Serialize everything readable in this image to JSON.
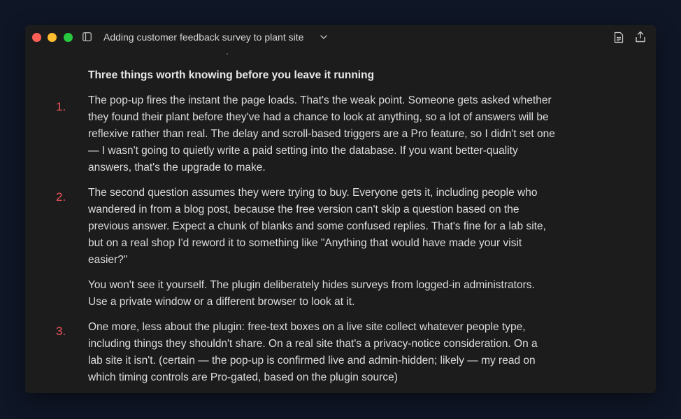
{
  "window": {
    "title": "Adding customer feedback survey to plant site"
  },
  "content": {
    "heading": "Three things worth knowing before you leave it running",
    "items": [
      {
        "number": "1.",
        "lines": [
          "The pop-up fires the instant the page loads. That's the weak point. Someone gets asked whether",
          "they found their plant before they've had a chance to look at anything, so a lot of answers will be",
          "reflexive rather than real. The delay and scroll-based triggers are a Pro feature, so I didn't set one",
          "— I wasn't going to quietly write a paid setting into the database. If you want better-quality",
          "answers, that's the upgrade to make."
        ]
      },
      {
        "number": "2.",
        "lines": [
          "The second question assumes they were trying to buy. Everyone gets it, including people who",
          "wandered in from a blog post, because the free version can't skip a question based on the",
          "previous answer. Expect a chunk of blanks and some confused replies. That's fine for a lab site,",
          "but on a real shop I'd reword it to something like \"Anything that would have made your visit",
          "easier?\""
        ]
      },
      {
        "number": "",
        "lines": [
          "You won't see it yourself. The plugin deliberately hides surveys from logged-in administrators.",
          "Use a private window or a different browser to look at it."
        ]
      },
      {
        "number": "3.",
        "lines": [
          "One more, less about the plugin: free-text boxes on a live site collect whatever people type,",
          "including things they shouldn't share. On a real site that's a privacy-notice consideration. On a",
          "lab site it isn't. (certain — the pop-up is confirmed live and admin-hidden; likely — my read on",
          "which timing controls are Pro-gated, based on the plugin source)"
        ]
      }
    ]
  },
  "icons": {
    "sidebar": "sidebar-toggle-icon",
    "chevron": "chevron-down-icon",
    "document": "document-icon",
    "share": "share-icon"
  },
  "colors": {
    "background": "#0f1626",
    "window": "#1c1c1c",
    "text": "#dcdcdc",
    "number_accent": "#f1525c",
    "close": "#fe5f57",
    "minimize": "#febc2e",
    "maximize": "#28c840"
  }
}
